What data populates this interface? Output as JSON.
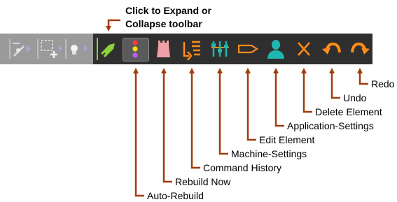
{
  "callout": {
    "line1": "Click to Expand or",
    "line2": "Collapse toolbar"
  },
  "labels": {
    "auto_rebuild": "Auto-Rebuild",
    "rebuild_now": "Rebuild Now",
    "command_history": "Command History",
    "machine_settings": "Machine-Settings",
    "edit_element": "Edit Element",
    "application_settings": "Application-Settings",
    "delete_element": "Delete Element",
    "undo": "Undo",
    "redo": "Redo"
  },
  "colors": {
    "toolbar_dark": "#2f2f2f",
    "toolbar_collapsed": "#9a9a9a",
    "arrow": "#a33a0b",
    "expand_green": "#8bd43a",
    "orange": "#ff8c1a",
    "pink": "#f0a0a8",
    "teal": "#1fb8b0"
  },
  "icons": [
    "sketch-icon",
    "select-add-icon",
    "bulb-icon",
    "expand-toggle-icon",
    "auto-rebuild-icon",
    "rebuild-now-icon",
    "command-history-icon",
    "machine-settings-icon",
    "edit-element-icon",
    "application-settings-icon",
    "delete-element-icon",
    "undo-icon",
    "redo-icon"
  ]
}
